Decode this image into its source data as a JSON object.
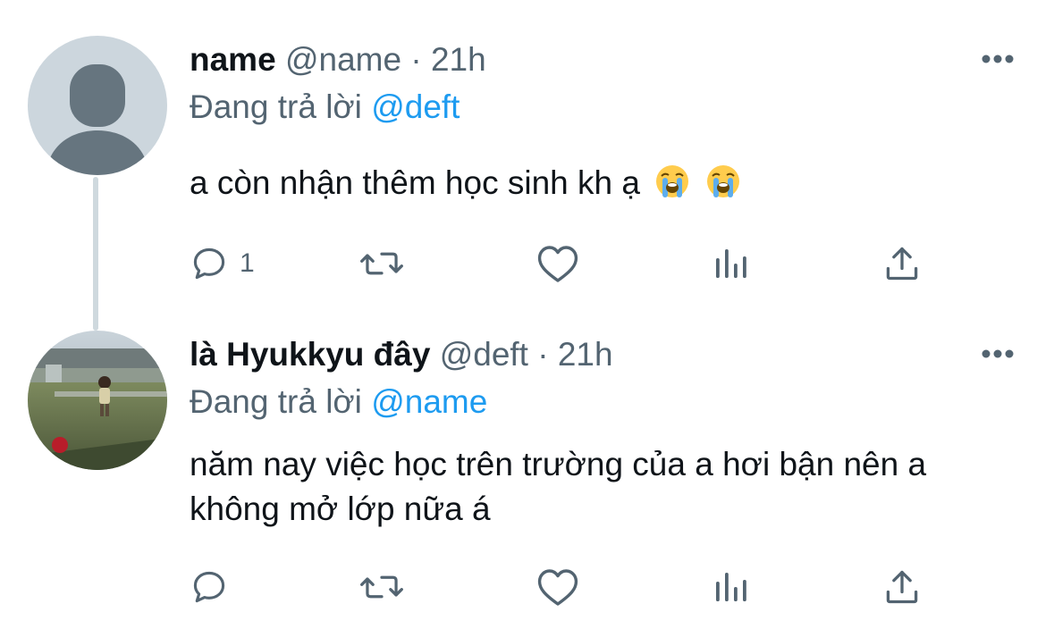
{
  "tweets": [
    {
      "name": "name",
      "handle": "@name",
      "separator": "·",
      "time": "21h",
      "reply_prefix": "Đang trả lời",
      "reply_to": "@deft",
      "text": "a còn nhận thêm học sinh kh ạ",
      "emojis": [
        "loudly-crying-face",
        "loudly-crying-face"
      ],
      "reply_count": "1",
      "avatar": "default-avatar"
    },
    {
      "name": "là Hyukkyu đây",
      "handle": "@deft",
      "separator": "·",
      "time": "21h",
      "reply_prefix": "Đang trả lời",
      "reply_to": "@name",
      "text": "năm nay việc học trên trường của a hơi bận nên a không mở lớp nữa á",
      "reply_count": "",
      "avatar": "photo-avatar"
    }
  ],
  "colors": {
    "text": "#0f1419",
    "muted": "#536471",
    "mention": "#1d9bf0",
    "thread_line": "#cfd9de"
  },
  "icons": [
    "reply-icon",
    "retweet-icon",
    "like-icon",
    "views-icon",
    "share-icon",
    "more-icon"
  ]
}
